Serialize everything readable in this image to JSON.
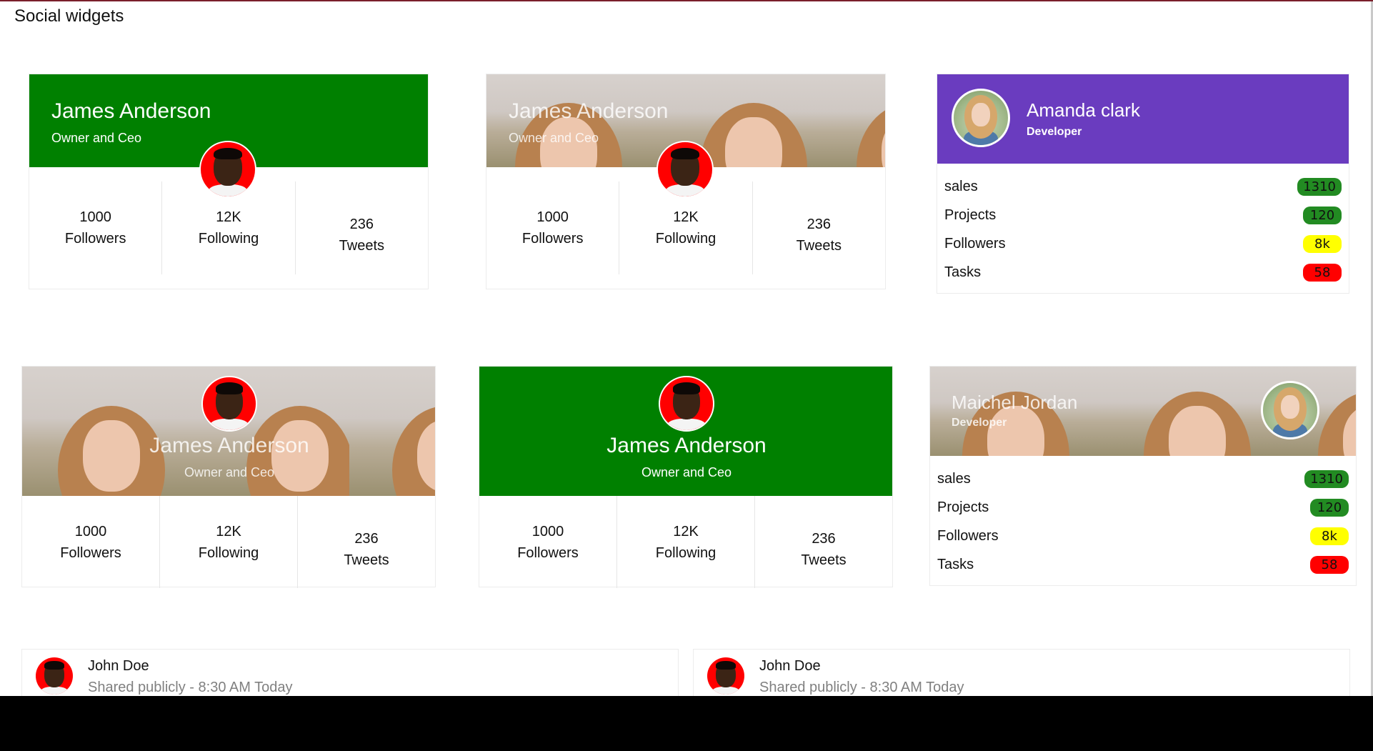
{
  "page": {
    "title": "Social widgets"
  },
  "profile_cards": [
    {
      "name": "James Anderson",
      "role": "Owner and Ceo",
      "stats": [
        {
          "value": "1000",
          "label": "Followers"
        },
        {
          "value": "12K",
          "label": "Following"
        },
        {
          "value": "236",
          "label": "Tweets"
        }
      ],
      "banner_color": "#008000"
    },
    {
      "name": "James Anderson",
      "role": "Owner and Ceo",
      "stats": [
        {
          "value": "1000",
          "label": "Followers"
        },
        {
          "value": "12K",
          "label": "Following"
        },
        {
          "value": "236",
          "label": "Tweets"
        }
      ]
    },
    {
      "name": "James Anderson",
      "role": "Owner and Ceo",
      "stats": [
        {
          "value": "1000",
          "label": "Followers"
        },
        {
          "value": "12K",
          "label": "Following"
        },
        {
          "value": "236",
          "label": "Tweets"
        }
      ]
    },
    {
      "name": "James Anderson",
      "role": "Owner and Ceo",
      "stats": [
        {
          "value": "1000",
          "label": "Followers"
        },
        {
          "value": "12K",
          "label": "Following"
        },
        {
          "value": "236",
          "label": "Tweets"
        }
      ],
      "banner_color": "#008000"
    }
  ],
  "summary_cards": [
    {
      "name": "Amanda clark",
      "role": "Developer",
      "banner_color": "#6a3cbf",
      "rows": [
        {
          "label": "sales",
          "value": "1310",
          "badge": "green"
        },
        {
          "label": "Projects",
          "value": "120",
          "badge": "green"
        },
        {
          "label": "Followers",
          "value": "8k",
          "badge": "yellow"
        },
        {
          "label": "Tasks",
          "value": "58",
          "badge": "red"
        }
      ]
    },
    {
      "name": "Maichel Jordan",
      "role": "Developer",
      "rows": [
        {
          "label": "sales",
          "value": "1310",
          "badge": "green"
        },
        {
          "label": "Projects",
          "value": "120",
          "badge": "green"
        },
        {
          "label": "Followers",
          "value": "8k",
          "badge": "yellow"
        },
        {
          "label": "Tasks",
          "value": "58",
          "badge": "red"
        }
      ]
    }
  ],
  "posts": [
    {
      "author": "John Doe",
      "meta": "Shared publicly - 8:30 AM Today"
    },
    {
      "author": "John Doe",
      "meta": "Shared publicly - 8:30 AM Today"
    }
  ],
  "colors": {
    "green": "#008000",
    "purple": "#6a3cbf",
    "badge_green": "#228b22",
    "badge_yellow": "#ffff00",
    "badge_red": "#ff0000"
  },
  "icons": {
    "user_avatar": "avatar-man-icon",
    "girl_avatar": "avatar-woman-icon"
  }
}
